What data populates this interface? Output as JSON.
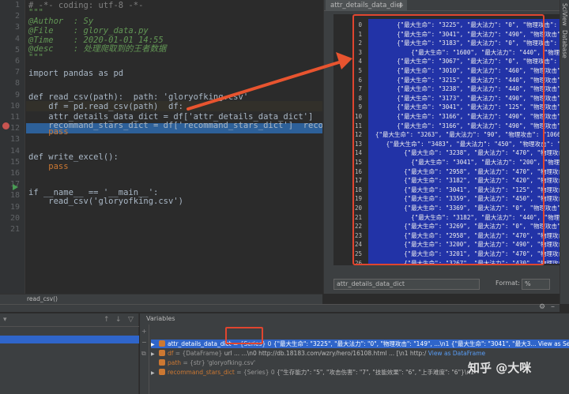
{
  "gutter_lines": [
    "1",
    "2",
    "3",
    "4",
    "5",
    "6",
    "7",
    "8",
    "9",
    "10",
    "11",
    "12",
    "13",
    "14",
    "15",
    "16",
    "17",
    "18",
    "19",
    "20",
    "21"
  ],
  "code": [
    {
      "t": "# -*- coding: utf-8 -*-",
      "c": "cm"
    },
    {
      "t": "\"\"\"",
      "c": "doc"
    },
    {
      "t": "@Author  : Sy",
      "c": "doc"
    },
    {
      "t": "@File    : glory_data.py",
      "c": "doc"
    },
    {
      "t": "@Time    : 2020-01-01 14:55",
      "c": "doc"
    },
    {
      "t": "@desc    : 处理爬取到的王者数据",
      "c": "doc"
    },
    {
      "t": "\"\"\"",
      "c": "doc"
    },
    {
      "t": "",
      "c": ""
    },
    {
      "t": "import pandas as pd",
      "c": ""
    },
    {
      "t": "",
      "c": ""
    },
    {
      "t": "def read_csv(path):  path: 'gloryofking.csv'",
      "c": ""
    },
    {
      "t": "    df = pd.read_csv(path)  df:",
      "c": ""
    },
    {
      "t": "    attr_details_data_dict = df['attr_details_data_dict']  attr_de",
      "c": ""
    },
    {
      "t": "    recommand_stars_dict = df['recommand_stars_dict']  recommand_s",
      "c": ""
    },
    {
      "t": "    pass",
      "c": "kw"
    },
    {
      "t": "",
      "c": ""
    },
    {
      "t": "",
      "c": ""
    },
    {
      "t": "def write_excel():",
      "c": ""
    },
    {
      "t": "    pass",
      "c": "kw"
    },
    {
      "t": "",
      "c": ""
    },
    {
      "t": "",
      "c": ""
    },
    {
      "t": "if __name__ == '__main__':",
      "c": ""
    },
    {
      "t": "    read_csv('gloryofking.csv')",
      "c": ""
    }
  ],
  "breadcrumb": "read_csv()",
  "viewer": {
    "tab_label": "attr_details_data_dict",
    "tab_add": "+",
    "expression": "attr_details_data_dict",
    "format_label": "Format:",
    "format_value": "%",
    "index": [
      "0",
      "1",
      "2",
      "3",
      "4",
      "5",
      "6",
      "7",
      "8",
      "9",
      "10",
      "11",
      "12",
      "13",
      "14",
      "15",
      "16",
      "17",
      "18",
      "19",
      "20",
      "21",
      "22",
      "23",
      "24",
      "25",
      "26"
    ],
    "rows": [
      "        {\"最大生命\": \"3225\", \"最大法力\": \"0\", \"物理攻击\": \"149\", \"法",
      "        {\"最大生命\": \"3041\", \"最大法力\": \"490\", \"物理攻击\": \"164\", \"",
      "        {\"最大生命\": \"3183\", \"最大法力\": \"0\", \"物理攻击\": \"159\", \"法",
      "            {\"最大生命\": \"1600\", \"最大法力\": \"440\", \"物理攻击\": \"",
      "        {\"最大生命\": \"3067\", \"最大法力\": \"0\", \"物理攻击\": \"154\", \"法",
      "        {\"最大生命\": \"3010\", \"最大法力\": \"460\", \"物理攻击\": \"162\", \"",
      "        {\"最大生命\": \"3215\", \"最大法力\": \"440\", \"物理攻击\": \"152\", \"",
      "        {\"最大生命\": \"3238\", \"最大法力\": \"440\", \"物理攻击\": \"171\", \"",
      "        {\"最大生命\": \"3173\", \"最大法力\": \"490\", \"物理攻击\": \"205\", \"",
      "        {\"最大生命\": \"3041\", \"最大法力\": \"125\", \"物理攻击\": \"171\", \"",
      "        {\"最大生命\": \"3166\", \"最大法力\": \"490\", \"物理攻击\": \"165\", \"法",
      "        {\"最大生命\": \"3166\", \"最大法力\": \"490\", \"物理攻击\": \"165\", \"",
      "  {\"最大生命\": \"3263\", \"最大法力\": \"90\", \"物理攻击\": \"1066\", \"法术攻击",
      "     {\"最大生命\": \"3483\", \"最大法力\": \"450\", \"物理攻击\": \"159\", \"法",
      "          {\"最大生命\": \"3238\", \"最大法力\": \"470\", \"物理攻击\": \"159\"",
      "            {\"最大生命\": \"3041\", \"最大法力\": \"200\", \"物理攻击\": \"180\"",
      "          {\"最大生命\": \"2958\", \"最大法力\": \"470\", \"物理攻击\": \"15",
      "          {\"最大生命\": \"3182\", \"最大法力\": \"420\", \"物理攻击\": \"161\", \"",
      "          {\"最大生命\": \"3041\", \"最大法力\": \"125\", \"物理攻击\": \"171\", \"",
      "          {\"最大生命\": \"3359\", \"最大法力\": \"450\", \"物理攻击\": \"178\", \"",
      "          {\"最大生命\": \"3369\", \"最大法力\": \"0\", \"物理攻击\": \"171\", \"",
      "            {\"最大生命\": \"3182\", \"最大法力\": \"440\", \"物理攻击\": \"171\"",
      "          {\"最大生命\": \"3269\", \"最大法力\": \"0\", \"物理攻击\": \"177\", \"",
      "          {\"最大生命\": \"2958\", \"最大法力\": \"470\", \"物理攻击\": \"159\", \"",
      "          {\"最大生命\": \"3200\", \"最大法力\": \"490\", \"物理攻击\": \"168\", \"",
      "          {\"最大生命\": \"3201\", \"最大法力\": \"470\", \"物理攻击\": \"163\", \"",
      "          {\"最大生命\": \"3267\", \"最大法力\": \"430\", \"物理攻击\": \"173\", \""
    ]
  },
  "right_strip": {
    "scimode": "SciView",
    "database": "Database"
  },
  "debugger": {
    "variables_title": "Variables",
    "rows": [
      {
        "name": "attr_details_data_dict",
        "type": "= {Series} 0",
        "value": "{\"最大生命\": \"3225\", \"最大法力\": \"0\", \"物理攻击\": \"149\", ...\\n1   {\"最大生命\": \"3041\", \"最大3...",
        "view": "View as Series",
        "selected": true,
        "expand": "▶",
        "icon_color": "#cc7832"
      },
      {
        "name": "df",
        "type": "= {DataFrame}",
        "value": "url  ...  ...\\n0   http://db.18183.com/wzry/hero/16108.html  ...  [\\n1   http:/",
        "view": "View as DataFrame",
        "selected": false,
        "expand": "▶",
        "icon_color": "#cc7832"
      },
      {
        "name": "path",
        "type": "= {str} 'gloryofking.csv'",
        "value": "",
        "view": "",
        "selected": false,
        "expand": "",
        "icon_color": "#cc7832"
      },
      {
        "name": "recommand_stars_dict",
        "type": "= {Series} 0",
        "value": "{\"生存能力\": \"5\", \"攻击伤害\": \"7\", \"技能效果\": \"6\", \"上手难度\": \"6\"}\\n1",
        "view": "",
        "selected": false,
        "expand": "▶",
        "icon_color": "#cc7832"
      }
    ]
  },
  "watermark": "知乎 @大咪"
}
